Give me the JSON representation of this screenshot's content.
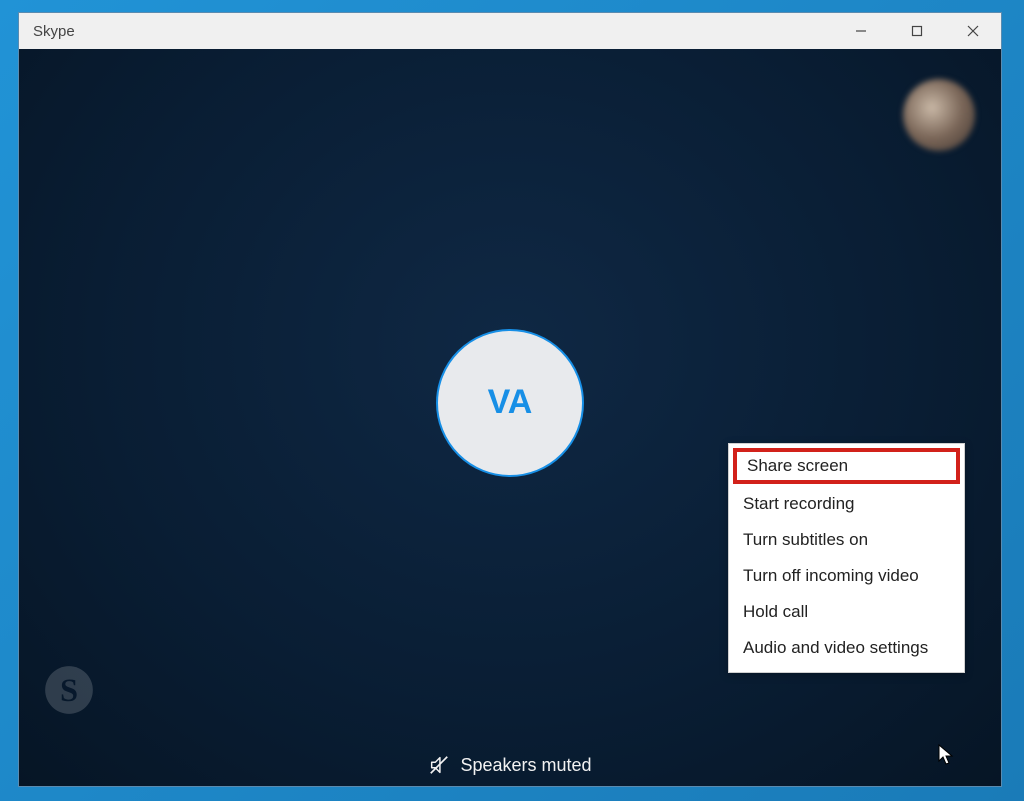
{
  "window": {
    "title": "Skype"
  },
  "call": {
    "avatar_initials": "VA",
    "status_text": "Speakers muted"
  },
  "menu": {
    "items": [
      "Share screen",
      "Start recording",
      "Turn subtitles on",
      "Turn off incoming video",
      "Hold call",
      "Audio and video settings"
    ]
  }
}
